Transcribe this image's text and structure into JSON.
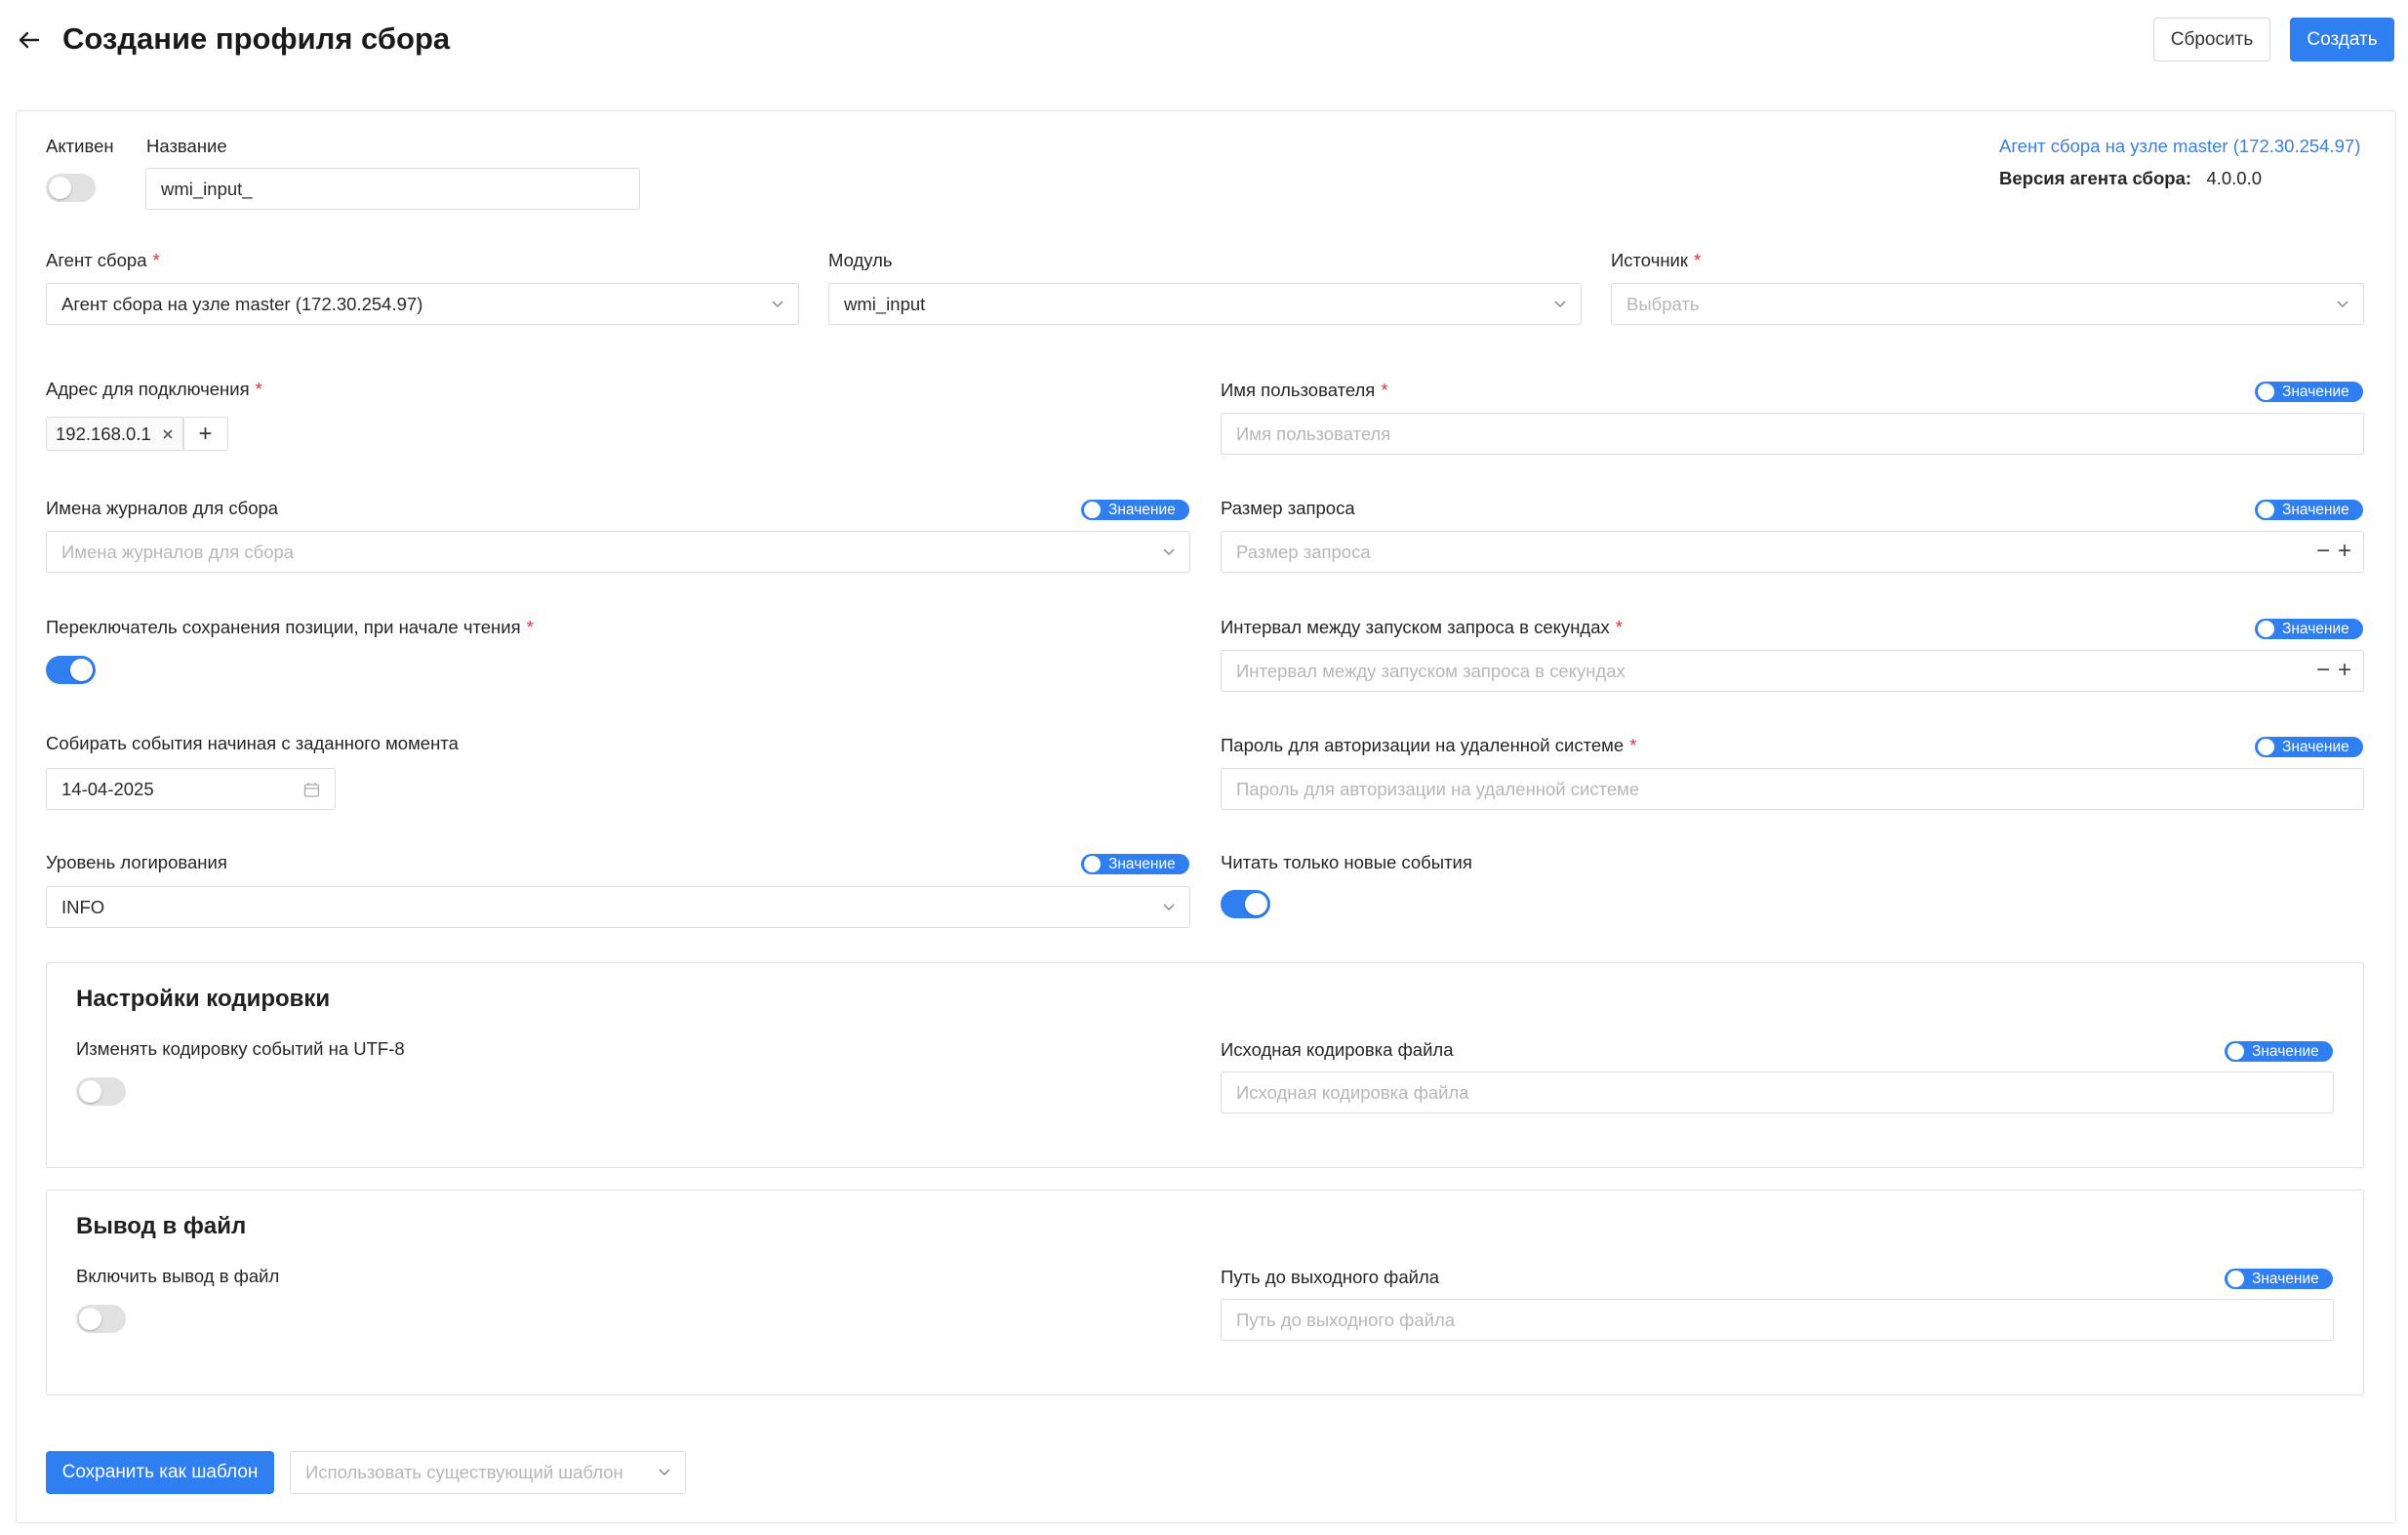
{
  "header": {
    "title": "Создание профиля сбора",
    "reset_label": "Сбросить",
    "create_label": "Создать"
  },
  "top": {
    "active_label": "Активен",
    "active": false,
    "name_label": "Название",
    "name_value": "wmi_input_",
    "agent_link": "Агент сбора на узле master (172.30.254.97)",
    "version_label": "Версия агента сбора:",
    "version_value": "4.0.0.0"
  },
  "selects": {
    "agent_label": "Агент сбора",
    "agent_value": "Агент сбора на узле master (172.30.254.97)",
    "module_label": "Модуль",
    "module_value": "wmi_input",
    "source_label": "Источник",
    "source_placeholder": "Выбрать"
  },
  "fields": {
    "address_label": "Адрес для подключения",
    "address_tag": "192.168.0.1",
    "username_label": "Имя пользователя",
    "username_placeholder": "Имя пользователя",
    "journals_label": "Имена журналов для сбора",
    "journals_placeholder": "Имена журналов для сбора",
    "request_size_label": "Размер запроса",
    "request_size_placeholder": "Размер запроса",
    "save_position_label": "Переключатель сохранения позиции, при начале чтения",
    "save_position": true,
    "interval_label": "Интервал между запуском запроса в секундах",
    "interval_placeholder": "Интервал между запуском запроса в секундах",
    "collect_from_label": "Собирать события начиная с заданного момента",
    "collect_from_value": "14-04-2025",
    "password_label": "Пароль для авторизации на удаленной системе",
    "password_placeholder": "Пароль для авторизации на удаленной системе",
    "log_level_label": "Уровень логирования",
    "log_level_value": "INFO",
    "read_new_label": "Читать только новые события",
    "read_new": true,
    "value_pill": "Значение"
  },
  "encoding": {
    "title": "Настройки кодировки",
    "utf8_label": "Изменять кодировку событий на UTF-8",
    "utf8": false,
    "source_enc_label": "Исходная кодировка файла",
    "source_enc_placeholder": "Исходная кодировка файла"
  },
  "file_output": {
    "title": "Вывод в файл",
    "enable_label": "Включить вывод в файл",
    "enable": false,
    "path_label": "Путь до выходного файла",
    "path_placeholder": "Путь до выходного файла"
  },
  "footer": {
    "save_template_label": "Сохранить как шаблон",
    "use_template_placeholder": "Использовать существующий шаблон"
  },
  "colors": {
    "accent": "#2f7ff0",
    "required": "#e0333a",
    "link": "#3a7fe0"
  }
}
